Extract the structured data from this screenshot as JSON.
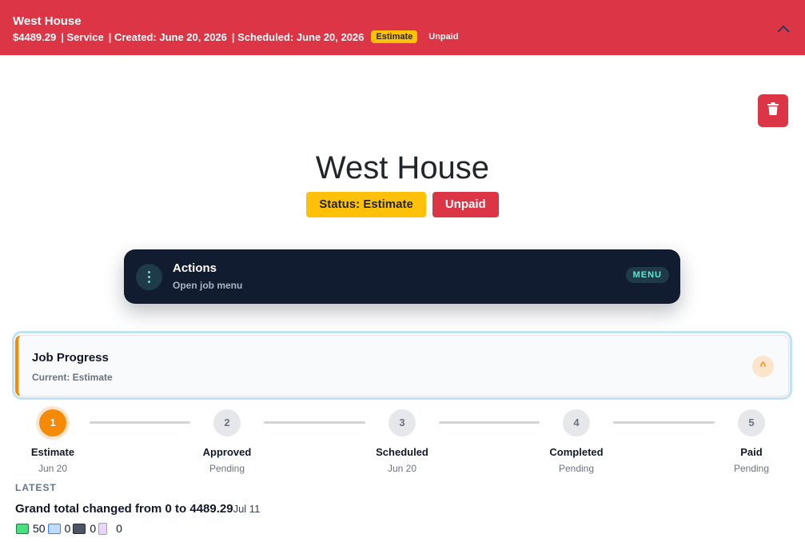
{
  "header": {
    "title": "West House",
    "price": "$4489.29",
    "type": "| Service",
    "created": "| Created: June 20, 2026",
    "scheduled": "| Scheduled: June 20, 2026",
    "status_badge": "Estimate",
    "payment_badge": "Unpaid",
    "collapse_icon": "chevron-up-icon"
  },
  "delete_icon": "trash-icon",
  "job": {
    "title": "West House",
    "status": "Status: Estimate",
    "payment": "Unpaid"
  },
  "actions": {
    "title": "Actions",
    "subtitle": "Open job menu",
    "menu_label": "MENU",
    "icon": "kebab-menu-icon"
  },
  "progress": {
    "title": "Job Progress",
    "current": "Current: Estimate",
    "toggle": "^",
    "steps": [
      {
        "num": "1",
        "label": "Estimate",
        "date": "Jun 20",
        "active": true
      },
      {
        "num": "2",
        "label": "Approved",
        "date": "Pending",
        "active": false
      },
      {
        "num": "3",
        "label": "Scheduled",
        "date": "Jun 20",
        "active": false
      },
      {
        "num": "4",
        "label": "Completed",
        "date": "Pending",
        "active": false
      },
      {
        "num": "5",
        "label": "Paid",
        "date": "Pending",
        "active": false
      }
    ]
  },
  "latest": {
    "label": "LATEST",
    "text": "Grand total changed from 0 to 4489.29",
    "date": "Jul 11",
    "counts": [
      {
        "icon": "cash-icon",
        "value": "50"
      },
      {
        "icon": "comment-icon",
        "value": "0"
      },
      {
        "icon": "camera-icon",
        "value": "0"
      },
      {
        "icon": "document-icon",
        "value": "0"
      }
    ]
  },
  "colors": {
    "danger": "#dc3545",
    "warning": "#ffc107",
    "accent_orange": "#f58a07",
    "actions_bg": "#111c30",
    "teal": "#5eead4"
  }
}
